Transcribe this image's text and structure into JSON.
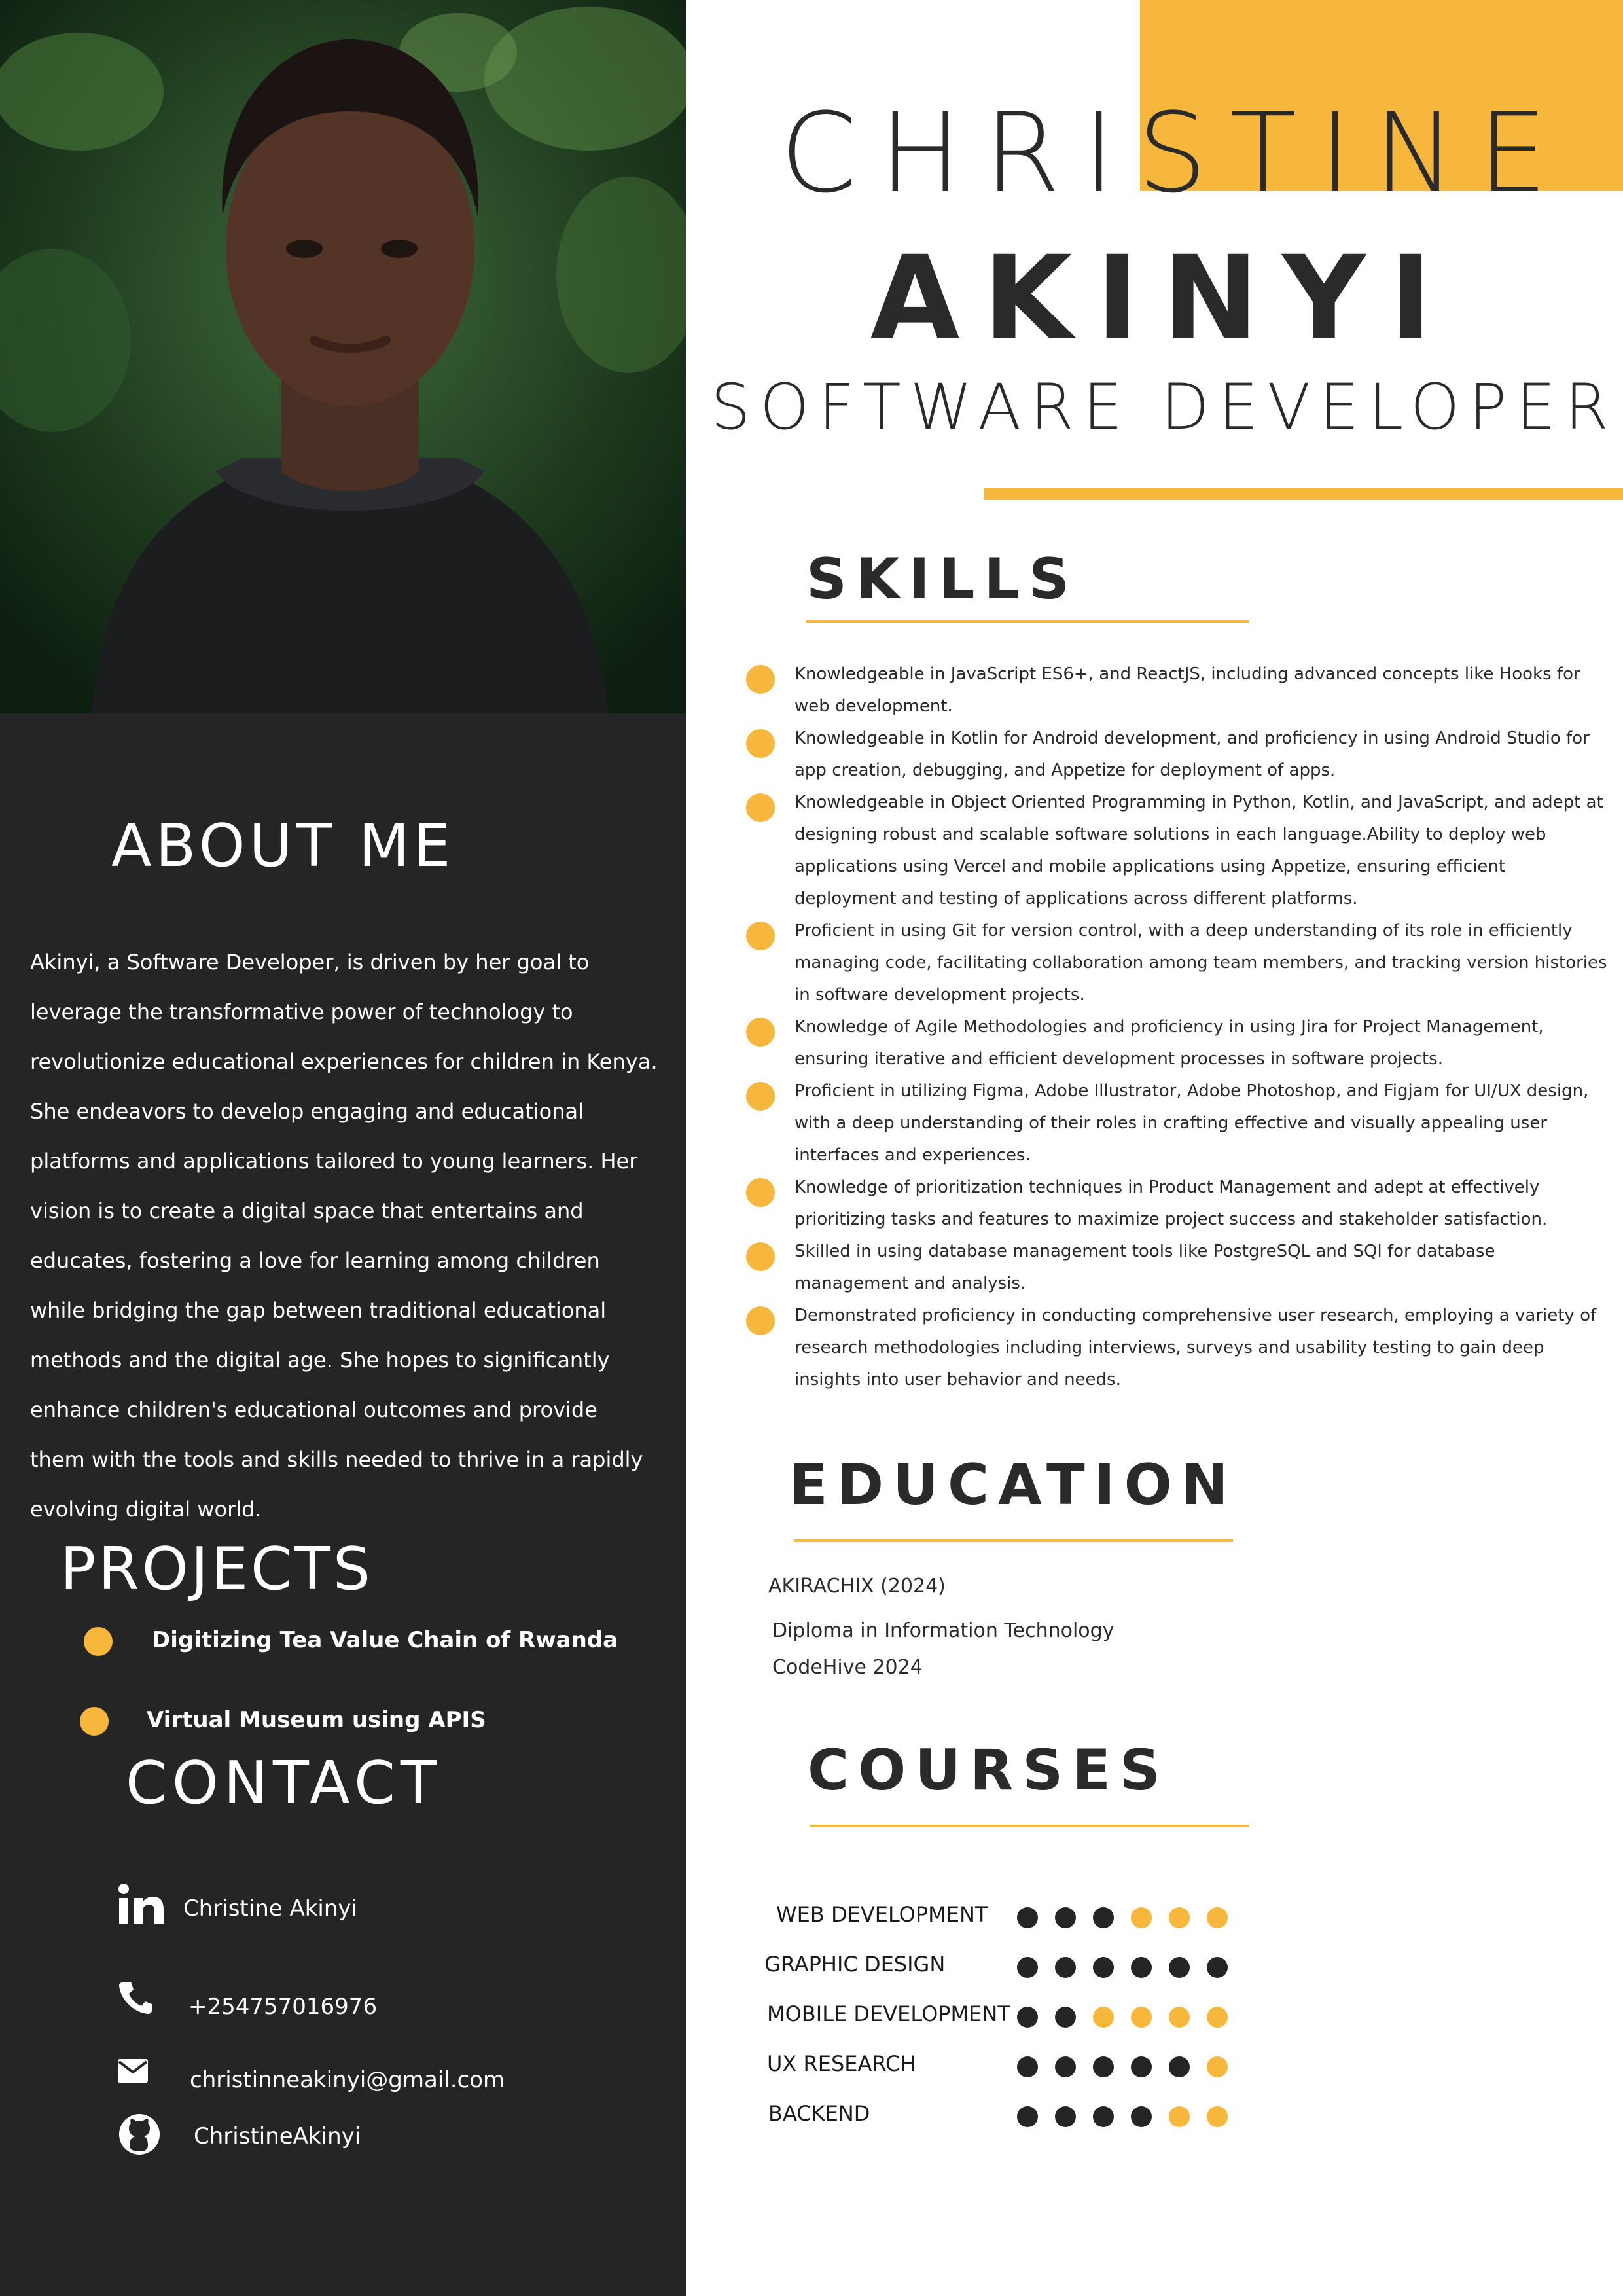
{
  "person": {
    "first_name": "CHRISTINE",
    "last_name": "AKINYI",
    "title": "SOFTWARE DEVELOPER"
  },
  "about": {
    "heading": "ABOUT ME",
    "text": "Akinyi, a Software Developer, is driven by her goal to leverage the transformative power of technology to revolutionize educational experiences for children in Kenya. She endeavors to develop engaging and educational platforms and applications tailored to young learners. Her vision is to create a digital space that entertains and educates, fostering a love for learning among children while bridging the gap between traditional educational methods and the digital age. She hopes to significantly enhance children's educational outcomes and provide them with the tools and skills needed to thrive in a rapidly evolving digital world."
  },
  "projects": {
    "heading": "PROJECTS",
    "items": [
      "Digitizing Tea Value Chain of Rwanda",
      "Virtual Museum using APIS"
    ]
  },
  "contact": {
    "heading": "CONTACT",
    "linkedin": "Christine Akinyi",
    "phone": "+254757016976",
    "email": "christinneakinyi@gmail.com",
    "github": "ChristineAkinyi"
  },
  "skills": {
    "heading": "SKILLS",
    "items": [
      "Knowledgeable in JavaScript ES6+, and ReactJS, including advanced concepts like Hooks for web development.",
      "Knowledgeable in Kotlin for Android development, and proficiency in using Android Studio for app creation, debugging, and Appetize for deployment of apps.",
      "Knowledgeable in Object Oriented Programming in Python, Kotlin, and JavaScript, and adept at designing robust and scalable software solutions in each language.Ability to deploy web applications using Vercel and mobile applications using Appetize, ensuring efficient deployment and testing of applications across different platforms.",
      "Proficient in using Git for version control, with a deep understanding of its role in efficiently managing code, facilitating collaboration among team members, and tracking version histories in software development projects.",
      "Knowledge of Agile Methodologies and proficiency in using Jira for Project Management, ensuring iterative and efficient development processes in software projects.",
      "Proficient in utilizing Figma, Adobe Illustrator, Adobe Photoshop, and Figjam for UI/UX design, with a deep understanding of their roles in crafting effective and visually appealing user interfaces and experiences.",
      "Knowledge of prioritization techniques in Product Management and adept at effectively prioritizing tasks and features to maximize project success and stakeholder satisfaction.",
      "Skilled in using database management tools like PostgreSQL and SQl for database management and analysis.",
      "Demonstrated proficiency in conducting comprehensive user research, employing a variety of research methodologies including interviews, surveys and usability testing to gain deep insights into user behavior and needs."
    ]
  },
  "education": {
    "heading": "EDUCATION",
    "institution": "AKIRACHIX  (2024)",
    "diploma": "Diploma in Information Technology",
    "other": "CodeHive 2024"
  },
  "courses": {
    "heading": "COURSES",
    "max_level": 6,
    "filled_color": "#262526",
    "empty_color": "#f7b73d",
    "items": [
      {
        "name": "WEB DEVELOPMENT",
        "level": 3
      },
      {
        "name": "GRAPHIC DESIGN",
        "level": 6
      },
      {
        "name": "MOBILE DEVELOPMENT",
        "level": 2
      },
      {
        "name": "UX RESEARCH",
        "level": 5
      },
      {
        "name": "BACKEND",
        "level": 4
      }
    ]
  },
  "colors": {
    "accent": "#f7b73d",
    "dark_panel": "#262526",
    "text_dark": "#2a2a2a"
  },
  "icons": [
    "linkedin-icon",
    "phone-icon",
    "email-icon",
    "github-icon"
  ]
}
